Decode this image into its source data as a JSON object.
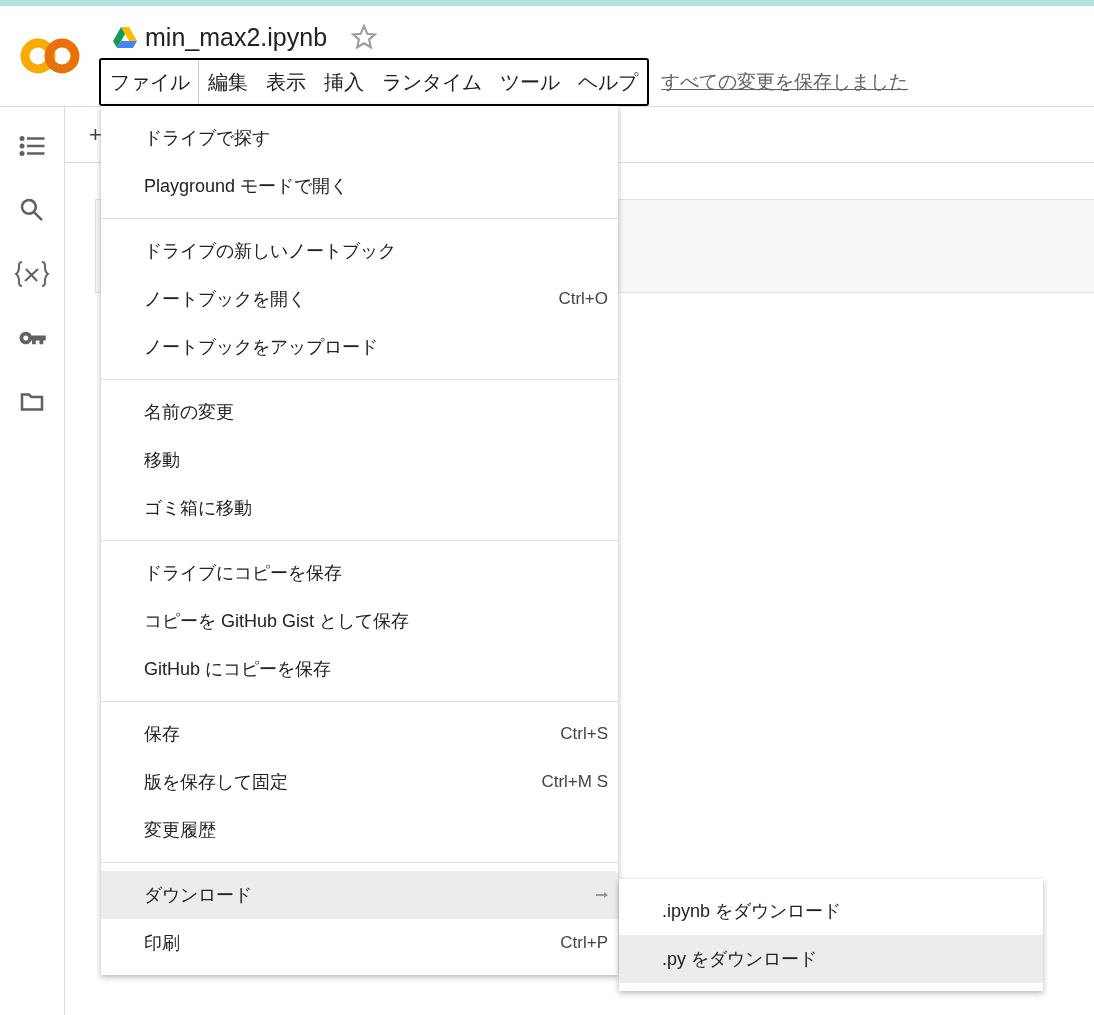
{
  "notebook": {
    "title": "min_max2.ipynb",
    "starred": false
  },
  "menubar": [
    {
      "label": "ファイル",
      "selected": true
    },
    {
      "label": "編集",
      "selected": false
    },
    {
      "label": "表示",
      "selected": false
    },
    {
      "label": "挿入",
      "selected": false
    },
    {
      "label": "ランタイム",
      "selected": false
    },
    {
      "label": "ツール",
      "selected": false
    },
    {
      "label": "ヘルプ",
      "selected": false
    }
  ],
  "save_status": "すべての変更を保存しました",
  "toolbar": {
    "add_label": "+"
  },
  "menu": {
    "groups": [
      [
        {
          "kind": "action",
          "label": "ドライブで探す",
          "highlighted": false
        },
        {
          "kind": "action",
          "label": "Playground モードで開く",
          "highlighted": false
        }
      ],
      [
        {
          "kind": "action",
          "label": "ドライブの新しいノートブック",
          "highlighted": false
        },
        {
          "kind": "action",
          "label": "ノートブックを開く",
          "shortcut": "Ctrl+O",
          "highlighted": false
        },
        {
          "kind": "action",
          "label": "ノートブックをアップロード",
          "highlighted": false
        }
      ],
      [
        {
          "kind": "action",
          "label": "名前の変更",
          "highlighted": false
        },
        {
          "kind": "action",
          "label": "移動",
          "highlighted": false
        },
        {
          "kind": "action",
          "label": "ゴミ箱に移動",
          "highlighted": false
        }
      ],
      [
        {
          "kind": "action",
          "label": "ドライブにコピーを保存",
          "highlighted": false
        },
        {
          "kind": "action",
          "label": "コピーを GitHub Gist として保存",
          "highlighted": false
        },
        {
          "kind": "action",
          "label": "GitHub にコピーを保存",
          "highlighted": false
        }
      ],
      [
        {
          "kind": "action",
          "label": "保存",
          "shortcut": "Ctrl+S",
          "highlighted": false
        },
        {
          "kind": "action",
          "label": "版を保存して固定",
          "shortcut": "Ctrl+M S",
          "highlighted": false
        },
        {
          "kind": "action",
          "label": "変更履歴",
          "highlighted": false
        }
      ],
      [
        {
          "kind": "submenu",
          "label": "ダウンロード",
          "highlighted": true
        },
        {
          "kind": "action",
          "label": "印刷",
          "shortcut": "Ctrl+P",
          "highlighted": false
        }
      ]
    ]
  },
  "submenu": [
    {
      "label": ".ipynb をダウンロード",
      "highlighted": false
    },
    {
      "label": ".py をダウンロード",
      "highlighted": true
    }
  ]
}
